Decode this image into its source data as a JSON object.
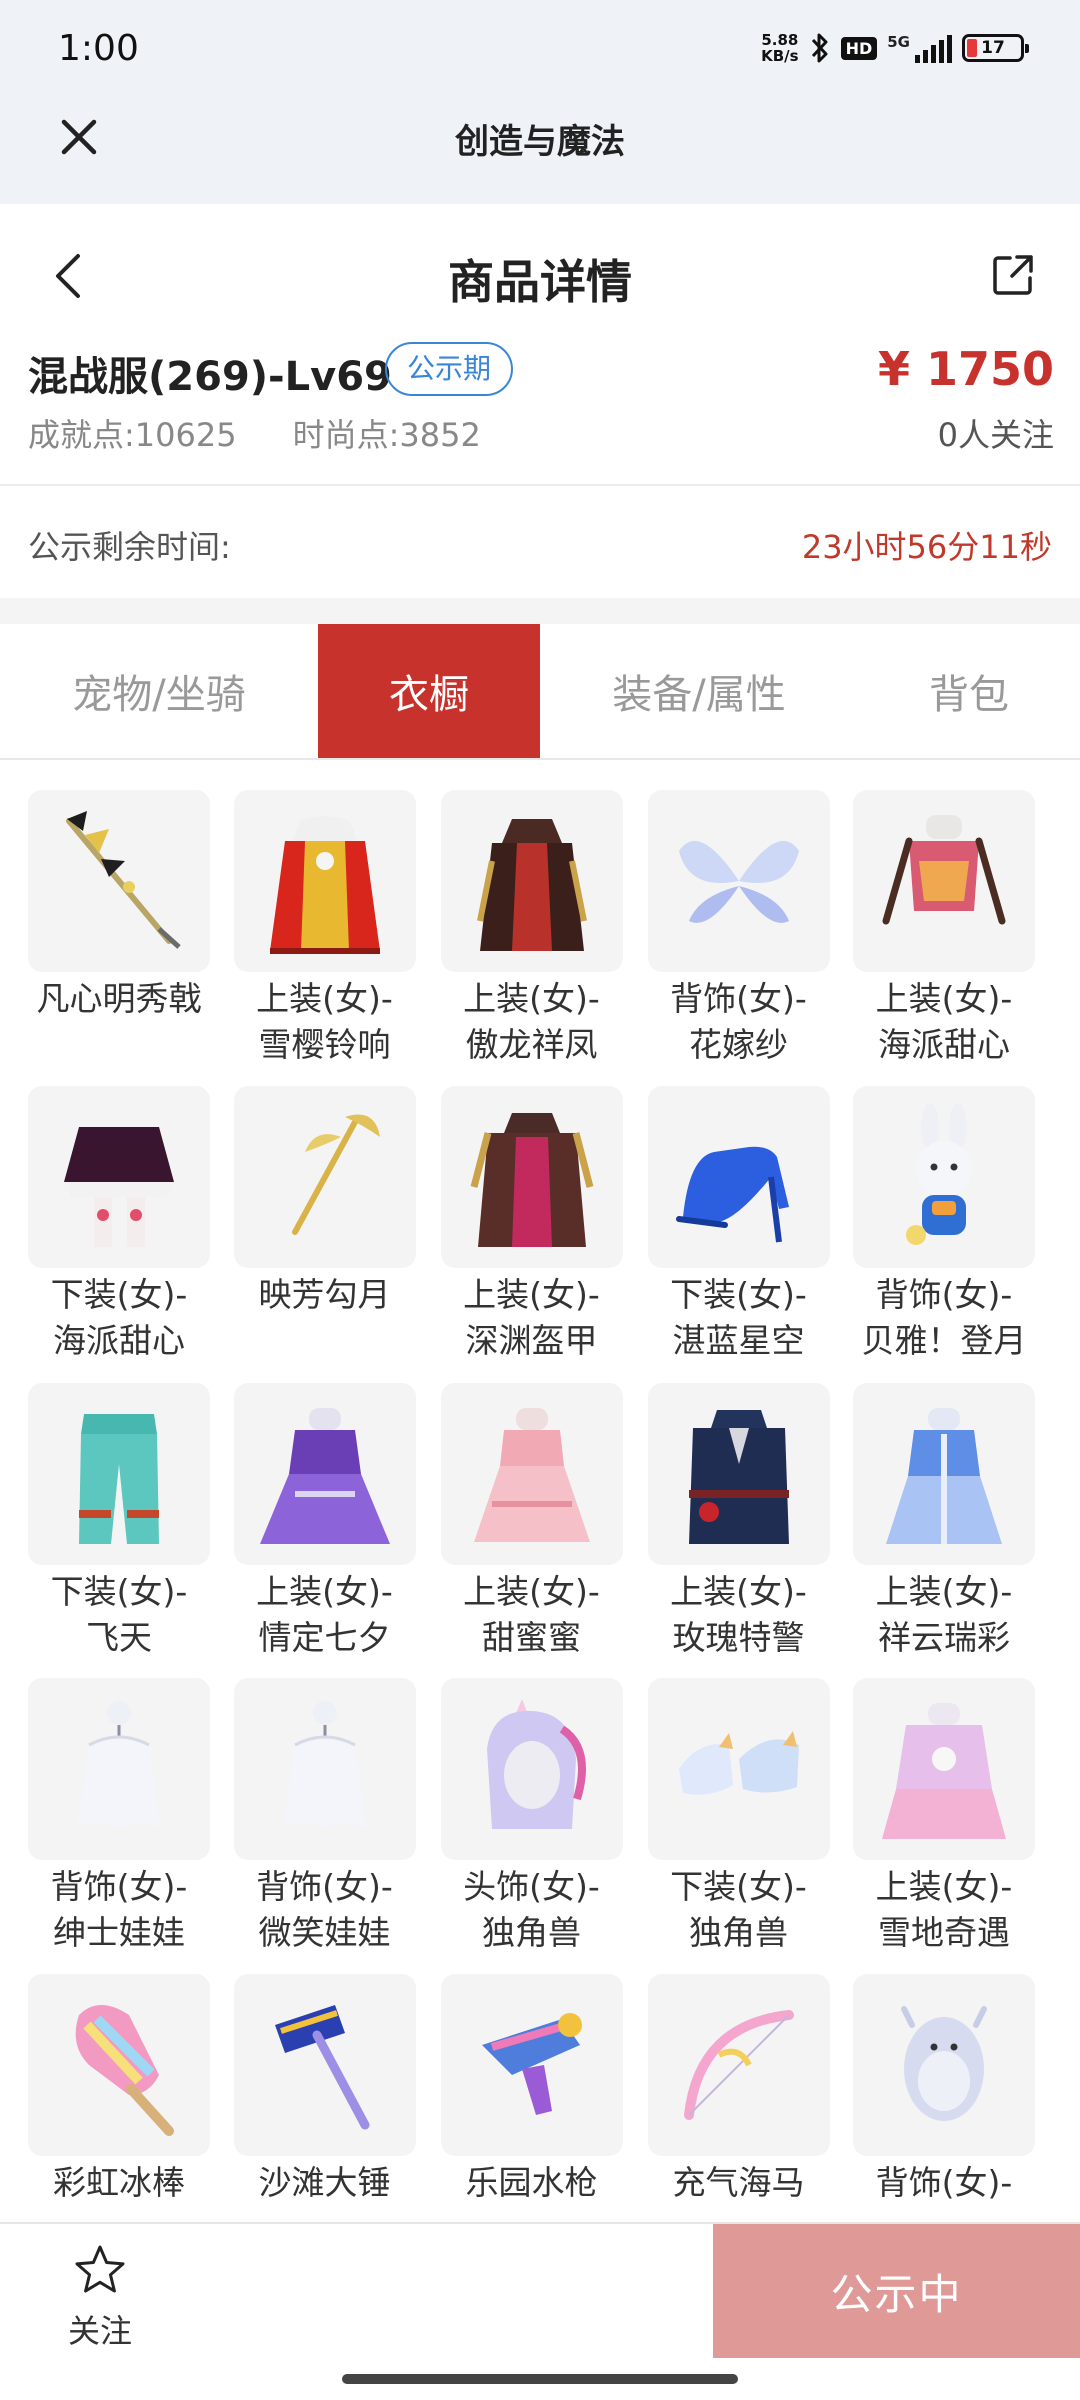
{
  "status_bar": {
    "time": "1:00",
    "net_speed_value": "5.88",
    "net_speed_unit": "KB/s",
    "hd": "HD",
    "network": "5G",
    "battery": "17"
  },
  "miniprogram": {
    "title": "创造与魔法"
  },
  "nav": {
    "title": "商品详情"
  },
  "product": {
    "name": "混战服(269)-Lv69",
    "badge": "公示期",
    "price": "¥ 1750",
    "achievement": "成就点:10625",
    "fashion": "时尚点:3852",
    "followers": "0人关注",
    "remaining_label": "公示剩余时间:",
    "remaining_time": "23小时56分11秒"
  },
  "tabs": [
    {
      "label": "宠物/坐骑",
      "active": false
    },
    {
      "label": "衣橱",
      "active": true
    },
    {
      "label": "装备/属性",
      "active": false
    },
    {
      "label": "背包",
      "active": false
    }
  ],
  "items": [
    {
      "line1": "凡心明秀戟",
      "line2": "",
      "icon": "halberd-icon"
    },
    {
      "line1": "上装(女)-",
      "line2": "雪樱铃响",
      "icon": "red-dress-icon"
    },
    {
      "line1": "上装(女)-",
      "line2": "傲龙祥凤",
      "icon": "dark-dress-icon"
    },
    {
      "line1": "背饰(女)-",
      "line2": "花嫁纱",
      "icon": "wings-icon"
    },
    {
      "line1": "上装(女)-",
      "line2": "海派甜心",
      "icon": "top-icon"
    },
    {
      "line1": "下装(女)-",
      "line2": "海派甜心",
      "icon": "skirt-icon"
    },
    {
      "line1": "映芳勾月",
      "line2": "",
      "icon": "golden-staff-icon"
    },
    {
      "line1": "上装(女)-",
      "line2": "深渊盔甲",
      "icon": "armor-icon"
    },
    {
      "line1": "下装(女)-",
      "line2": "湛蓝星空",
      "icon": "high-heel-icon"
    },
    {
      "line1": "背饰(女)-",
      "line2": "贝雅！登月",
      "icon": "bunny-icon"
    },
    {
      "line1": "下装(女)-",
      "line2": "飞天",
      "icon": "pants-icon"
    },
    {
      "line1": "上装(女)-",
      "line2": "情定七夕",
      "icon": "purple-gown-icon"
    },
    {
      "line1": "上装(女)-",
      "line2": "甜蜜蜜",
      "icon": "pink-dress-icon"
    },
    {
      "line1": "上装(女)-",
      "line2": "玫瑰特警",
      "icon": "uniform-icon"
    },
    {
      "line1": "上装(女)-",
      "line2": "祥云瑞彩",
      "icon": "blue-dress-icon"
    },
    {
      "line1": "背饰(女)-",
      "line2": "绅士娃娃",
      "icon": "ghost-doll-icon"
    },
    {
      "line1": "背饰(女)-",
      "line2": "微笑娃娃",
      "icon": "ghost-doll-icon"
    },
    {
      "line1": "头饰(女)-",
      "line2": "独角兽",
      "icon": "unicorn-hood-icon"
    },
    {
      "line1": "下装(女)-",
      "line2": "独角兽",
      "icon": "unicorn-shoes-icon"
    },
    {
      "line1": "上装(女)-",
      "line2": "雪地奇遇",
      "icon": "pink-coat-icon"
    },
    {
      "line1": "彩虹冰棒",
      "line2": "",
      "icon": "popsicle-icon"
    },
    {
      "line1": "沙滩大锤",
      "line2": "",
      "icon": "hammer-icon"
    },
    {
      "line1": "乐园水枪",
      "line2": "",
      "icon": "water-gun-icon"
    },
    {
      "line1": "充气海马",
      "line2": "",
      "icon": "bow-icon"
    },
    {
      "line1": "背饰(女)-",
      "line2": "",
      "icon": "seal-icon"
    }
  ],
  "bottom": {
    "follow_label": "关注",
    "cta_label": "公示中"
  }
}
